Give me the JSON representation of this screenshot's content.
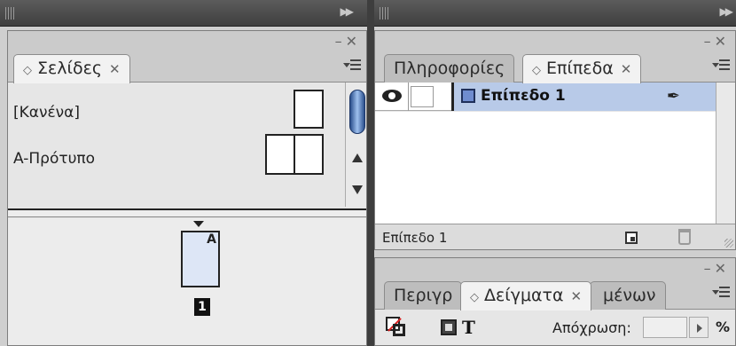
{
  "pages_panel": {
    "tab_label": "Σελίδες",
    "masters": [
      {
        "label": "[Κανένα]"
      },
      {
        "label": "A-Πρότυπο"
      }
    ],
    "page": {
      "master_letter": "A",
      "number": "1"
    }
  },
  "layers_panel": {
    "tabs": [
      {
        "label": "Πληροφορίες"
      },
      {
        "label": "Επίπεδα"
      }
    ],
    "layers": [
      {
        "name": "Επίπεδο 1",
        "color": "#6f8ccf"
      }
    ],
    "footer_label": "Επίπεδο 1"
  },
  "swatches_panel": {
    "tabs": [
      {
        "label": "Περιγρ"
      },
      {
        "label": "Δείγματα"
      },
      {
        "label": "μένων"
      }
    ],
    "fmt_text_glyph": "T",
    "tint_label": "Απόχρωση:",
    "tint_value": "",
    "tint_unit": "%"
  },
  "colors": {
    "selection": "#b8cae8",
    "page_fill": "#dde6f6",
    "scroll_thumb": "#2a4f8c"
  }
}
